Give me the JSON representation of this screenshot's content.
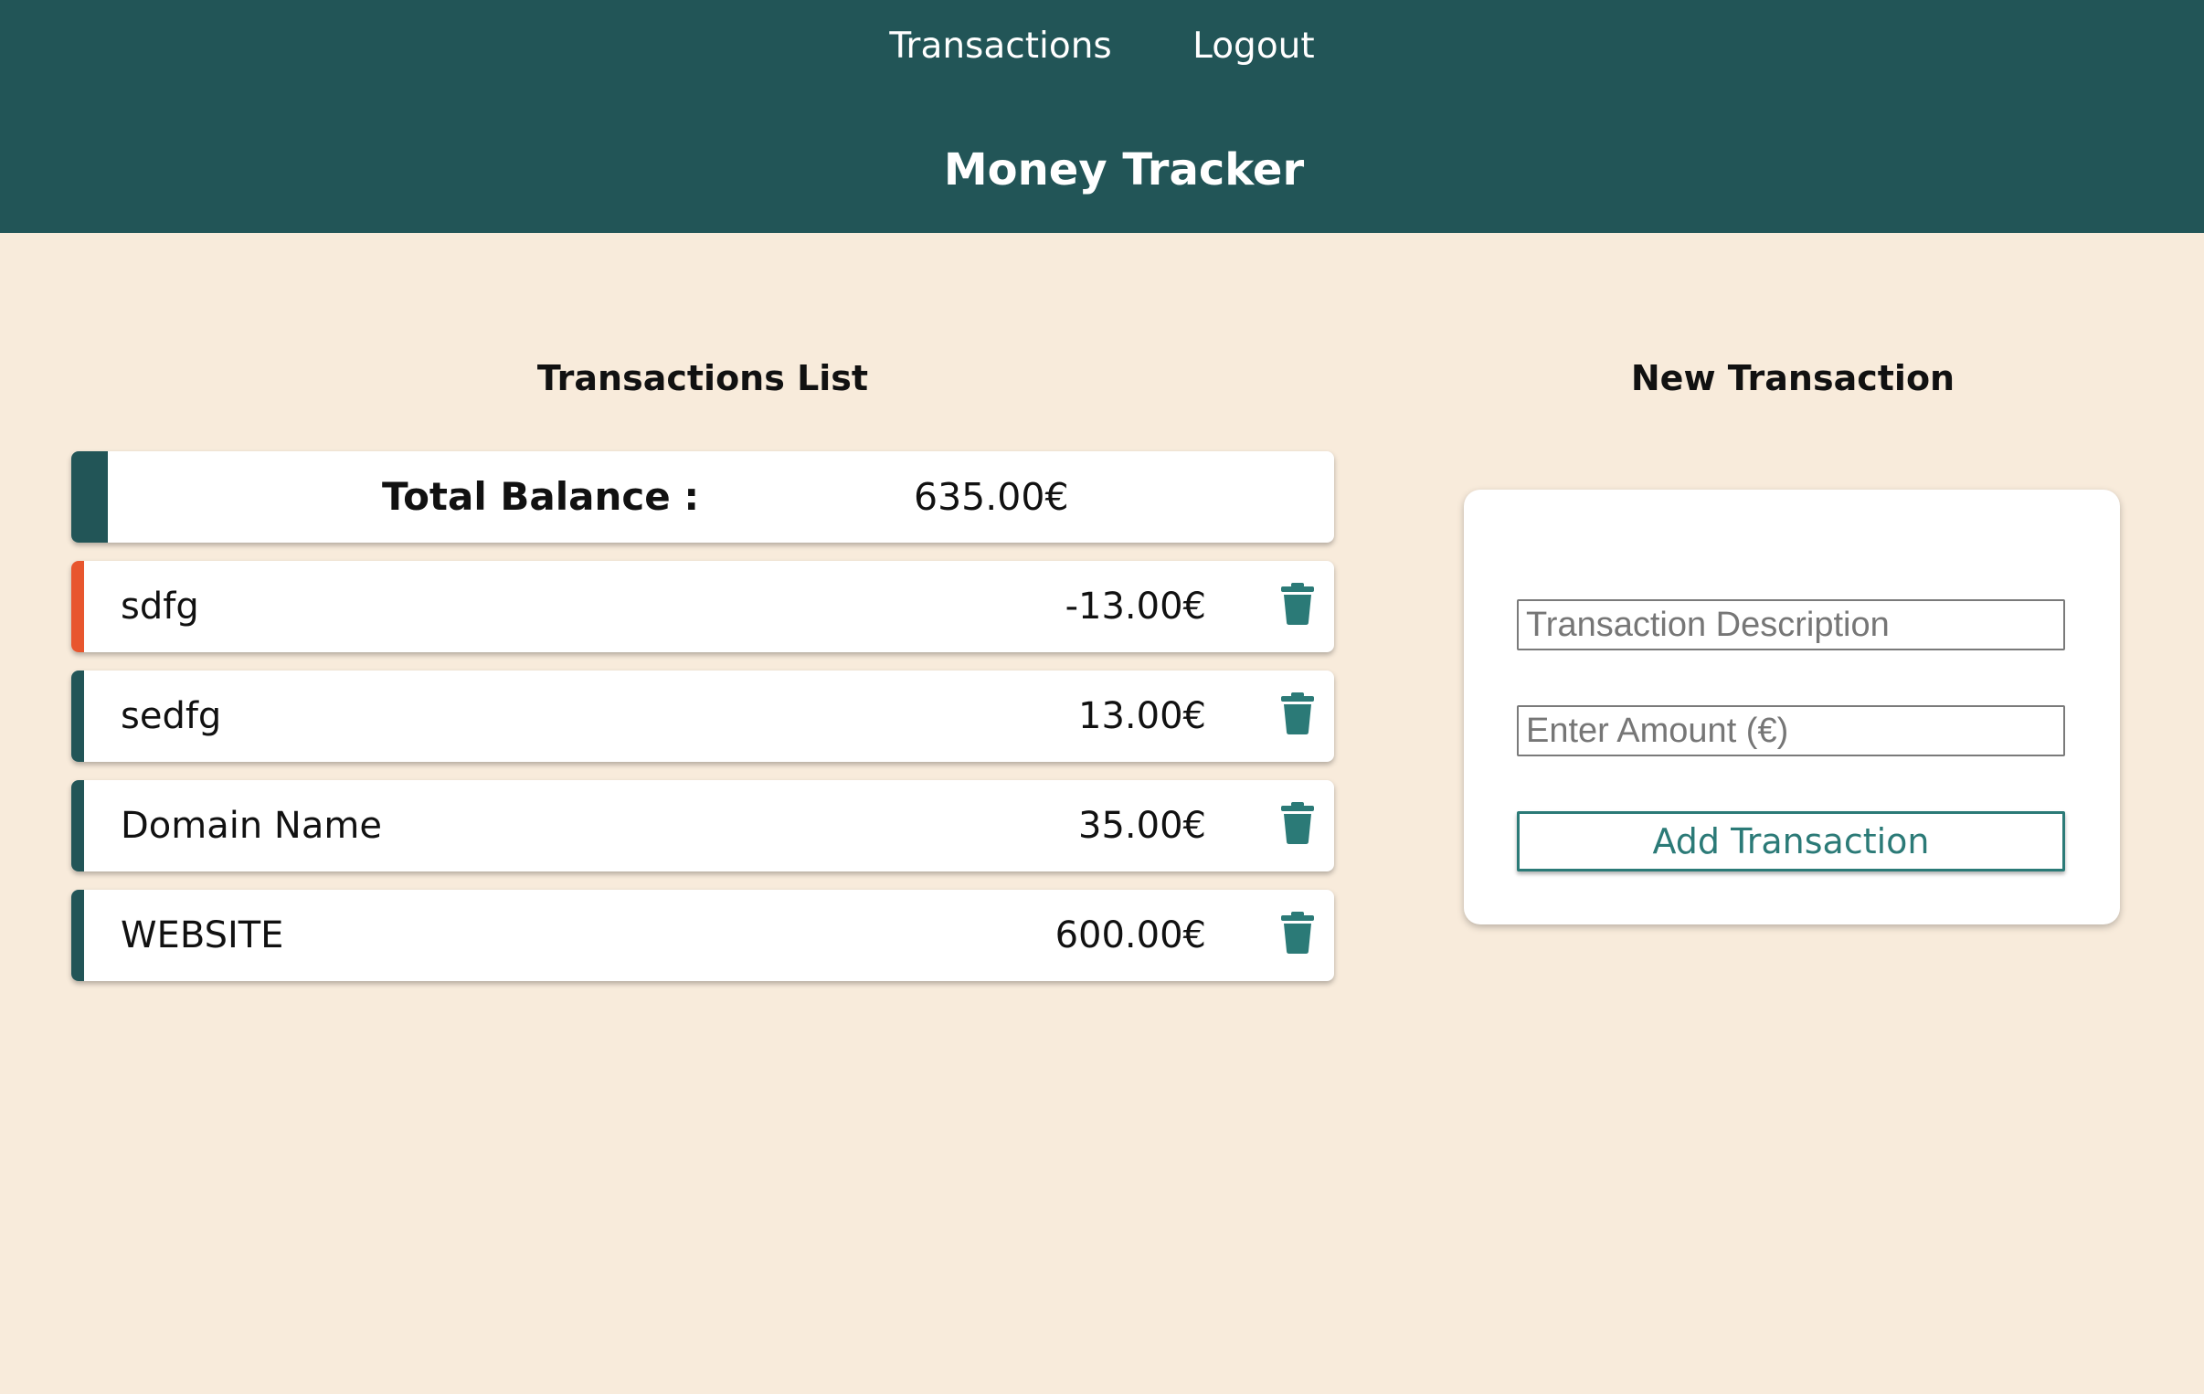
{
  "nav": {
    "items": [
      {
        "label": "Transactions"
      },
      {
        "label": "Logout"
      }
    ]
  },
  "header": {
    "title": "Money Tracker"
  },
  "list": {
    "title": "Transactions List",
    "balance": {
      "label": "Total Balance :",
      "value": "635.00€"
    },
    "transactions": [
      {
        "description": "sdfg",
        "amount": "-13.00€",
        "type": "negative"
      },
      {
        "description": "sedfg",
        "amount": "13.00€",
        "type": "positive"
      },
      {
        "description": "Domain Name",
        "amount": "35.00€",
        "type": "positive"
      },
      {
        "description": "WEBSITE",
        "amount": "600.00€",
        "type": "positive"
      }
    ]
  },
  "form": {
    "title": "New Transaction",
    "description_placeholder": "Transaction Description",
    "description_value": "",
    "amount_placeholder": "Enter Amount (€)",
    "amount_value": "",
    "submit_label": "Add Transaction"
  },
  "colors": {
    "header_bg": "#225557",
    "page_bg": "#f8ebdb",
    "positive_stripe": "#225557",
    "negative_stripe": "#e8562e",
    "accent": "#2b7a77"
  },
  "icons": {
    "delete": "trash-icon"
  }
}
